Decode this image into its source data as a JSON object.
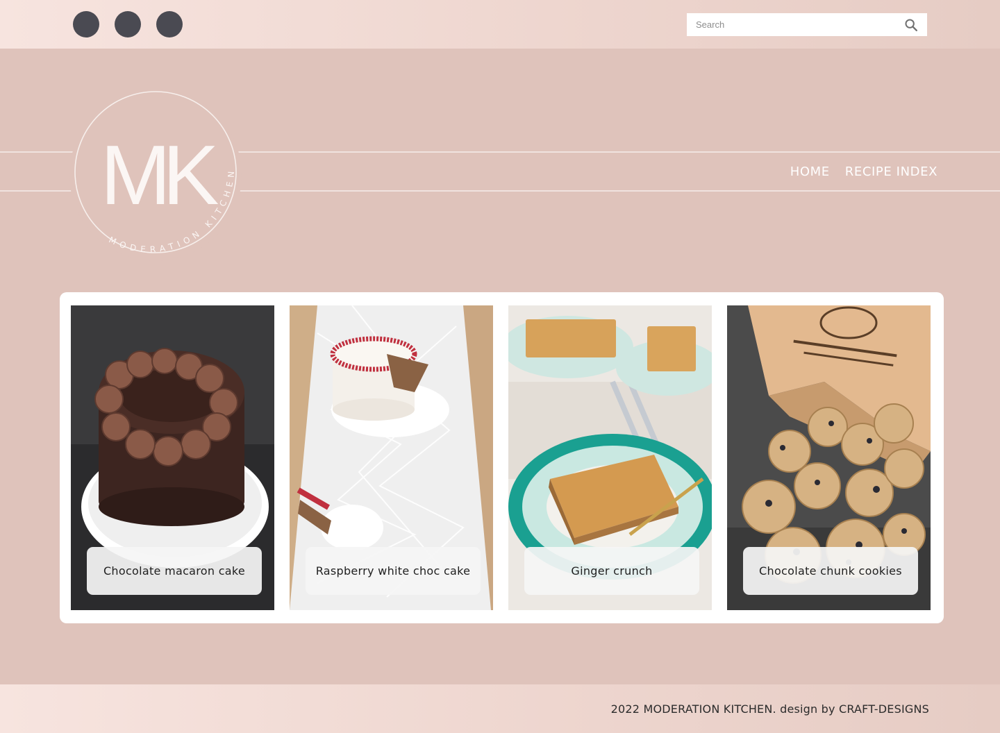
{
  "header": {
    "social_links": [
      {
        "name": "social-link-1"
      },
      {
        "name": "social-link-2"
      },
      {
        "name": "social-link-3"
      }
    ],
    "search": {
      "placeholder": "Search",
      "icon": "search-icon"
    }
  },
  "brand": {
    "monogram": "MK",
    "ring_text": "MODERATION KITCHEN"
  },
  "nav": {
    "items": [
      {
        "label": "HOME"
      },
      {
        "label": "RECIPE INDEX"
      }
    ]
  },
  "recipes": [
    {
      "title": "Chocolate macaron cake"
    },
    {
      "title": "Raspberry white choc cake"
    },
    {
      "title": "Ginger crunch"
    },
    {
      "title": "Chocolate chunk cookies"
    }
  ],
  "footer": {
    "text": "2022 MODERATION KITCHEN. design by CRAFT-DESIGNS"
  },
  "colors": {
    "page_bg": "#dfc3bb",
    "bar_gradient_start": "#f7e4df",
    "social_circle": "#4a4a52",
    "nav_text": "#ffffff"
  }
}
